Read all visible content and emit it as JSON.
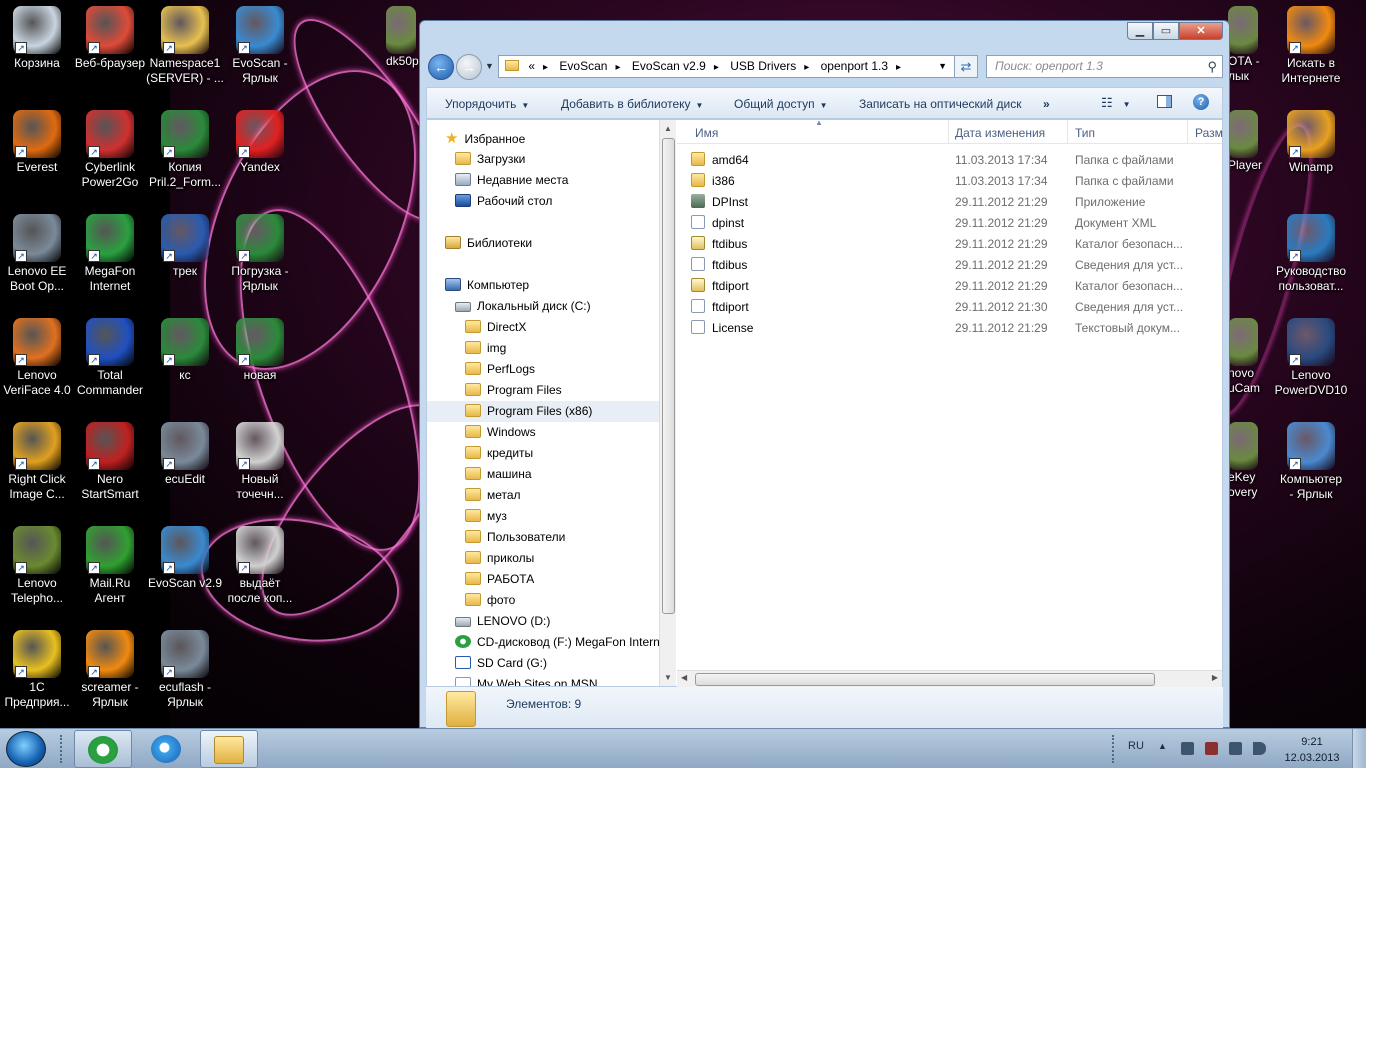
{
  "desktop": {
    "icons_left": [
      {
        "name": "recycle-bin",
        "label": "Корзина",
        "color": "#c8d4e0"
      },
      {
        "name": "web-browser",
        "label": "Веб-браузер",
        "color": "#dd4b39"
      },
      {
        "name": "namespace1",
        "label": "Namespace1\n(SERVER) - ...",
        "color": "#e8c050"
      },
      {
        "name": "evoscan-shortcut",
        "label": "EvoScan -\nЯрлык",
        "color": "#3a8ad0"
      },
      {
        "name": "everest",
        "label": "Everest",
        "color": "#e06a10"
      },
      {
        "name": "cyberlink-power2go",
        "label": "Cyberlink\nPower2Go",
        "color": "#d03030"
      },
      {
        "name": "kopiya-pril",
        "label": "Копия\nPril.2_Form...",
        "color": "#2a8a3a"
      },
      {
        "name": "yandex",
        "label": "Yandex",
        "color": "#e02020"
      },
      {
        "name": "lenovo-ee-boot",
        "label": "Lenovo EE\nBoot Op...",
        "color": "#7a8a9a"
      },
      {
        "name": "megafon-internet",
        "label": "MegaFon\nInternet",
        "color": "#2aa040"
      },
      {
        "name": "trek-doc",
        "label": "трек",
        "color": "#2a5ab0"
      },
      {
        "name": "pogruzka-shortcut",
        "label": "Погрузка -\nЯрлык",
        "color": "#2a8a3a"
      },
      {
        "name": "lenovo-veriface",
        "label": "Lenovo\nVeriFace 4.0",
        "color": "#e07020"
      },
      {
        "name": "total-commander",
        "label": "Total\nCommander",
        "color": "#2050c0"
      },
      {
        "name": "ks-xls",
        "label": "кс",
        "color": "#2a8a3a"
      },
      {
        "name": "novaya-xls",
        "label": "новая",
        "color": "#2a8a3a"
      },
      {
        "name": "right-click-image",
        "label": "Right Click\nImage C...",
        "color": "#e0a020"
      },
      {
        "name": "nero-startsmart",
        "label": "Nero\nStartSmart",
        "color": "#c02020"
      },
      {
        "name": "ecuedit",
        "label": "ecuEdit",
        "color": "#7a8a9a"
      },
      {
        "name": "novy-tochechny",
        "label": "Новый\nточечн...",
        "color": "#d0d0d0"
      },
      {
        "name": "lenovo-telephony",
        "label": "Lenovo\nTelepho...",
        "color": "#6a8a30"
      },
      {
        "name": "mailru-agent",
        "label": "Mail.Ru\nАгент",
        "color": "#30a030"
      },
      {
        "name": "evoscan-v29",
        "label": "EvoScan v2.9",
        "color": "#3a8ad0"
      },
      {
        "name": "vydaet-posle",
        "label": "выдаёт\nпосле коп...",
        "color": "#d0d0d0"
      },
      {
        "name": "1c-enterprise",
        "label": "1С\nПредприя...",
        "color": "#e8c020"
      },
      {
        "name": "screamer-shortcut",
        "label": "screamer -\nЯрлык",
        "color": "#f08a10"
      },
      {
        "name": "ecuflash-shortcut",
        "label": "ecuflash -\nЯрлык",
        "color": "#7a8a9a"
      }
    ],
    "icons_right": [
      {
        "name": "search-internet",
        "label": "Искать в\nИнтернете",
        "color": "#f08a10"
      },
      {
        "name": "winamp",
        "label": "Winamp",
        "color": "#e8a020"
      },
      {
        "name": "lenovo-user-guide",
        "label": "Руководство\nпользоват...",
        "color": "#2a7ac0"
      },
      {
        "name": "lenovo-powerdvd",
        "label": "Lenovo\nPowerDVD10",
        "color": "#2a4a80"
      },
      {
        "name": "computer-shortcut",
        "label": "Компьютер\n- Ярлык",
        "color": "#4a8ad0"
      }
    ],
    "icons_partial": [
      {
        "name": "dk50-partial",
        "label": "dk50p"
      },
      {
        "name": "ota-partial",
        "label": "ОТА -\nлык"
      },
      {
        "name": "kmplayer-partial",
        "label": "Player"
      },
      {
        "name": "lenovo-ucam-partial",
        "label": "novo\nuCam"
      },
      {
        "name": "onekey-partial",
        "label": "eKey\novery"
      }
    ]
  },
  "explorer": {
    "breadcrumb_prefix": "«",
    "breadcrumb": [
      "EvoScan",
      "EvoScan v2.9",
      "USB Drivers",
      "openport 1.3"
    ],
    "search_placeholder": "Поиск: openport 1.3",
    "toolbar": {
      "organize": "Упорядочить",
      "add_to_library": "Добавить в библиотеку",
      "share": "Общий доступ",
      "burn": "Записать на оптический диск",
      "more": "»"
    },
    "nav": {
      "favorites": "Избранное",
      "downloads": "Загрузки",
      "recent": "Недавние места",
      "desktop": "Рабочий стол",
      "libraries": "Библиотеки",
      "computer": "Компьютер",
      "local_disk": "Локальный диск (C:)",
      "folders": [
        "DirectX",
        "img",
        "PerfLogs",
        "Program Files",
        "Program Files (x86)",
        "Windows",
        "кредиты",
        "машина",
        "метал",
        "муз",
        "Пользователи",
        "приколы",
        "РАБОТА",
        "фото"
      ],
      "lenovo_d": "LENOVO (D:)",
      "cd_drive": "CD-дисковод (F:) MegaFon Interne",
      "sd_card": "SD Card (G:)",
      "msn": "My Web Sites on MSN"
    },
    "columns": {
      "name": "Имя",
      "date": "Дата изменения",
      "type": "Тип",
      "size": "Разм"
    },
    "files": [
      {
        "name": "amd64",
        "date": "11.03.2013 17:34",
        "type": "Папка с файлами",
        "kind": "folder"
      },
      {
        "name": "i386",
        "date": "11.03.2013 17:34",
        "type": "Папка с файлами",
        "kind": "folder"
      },
      {
        "name": "DPInst",
        "date": "29.11.2012 21:29",
        "type": "Приложение",
        "kind": "app"
      },
      {
        "name": "dpinst",
        "date": "29.11.2012 21:29",
        "type": "Документ XML",
        "kind": "doc"
      },
      {
        "name": "ftdibus",
        "date": "29.11.2012 21:29",
        "type": "Каталог безопасн...",
        "kind": "cat"
      },
      {
        "name": "ftdibus",
        "date": "29.11.2012 21:29",
        "type": "Сведения для уст...",
        "kind": "doc"
      },
      {
        "name": "ftdiport",
        "date": "29.11.2012 21:29",
        "type": "Каталог безопасн...",
        "kind": "cat"
      },
      {
        "name": "ftdiport",
        "date": "29.11.2012 21:30",
        "type": "Сведения для уст...",
        "kind": "doc"
      },
      {
        "name": "License",
        "date": "29.11.2012 21:29",
        "type": "Текстовый докум...",
        "kind": "doc"
      }
    ],
    "status": "Элементов: 9"
  },
  "taskbar": {
    "language": "RU",
    "time": "9:21",
    "date": "12.03.2013"
  }
}
